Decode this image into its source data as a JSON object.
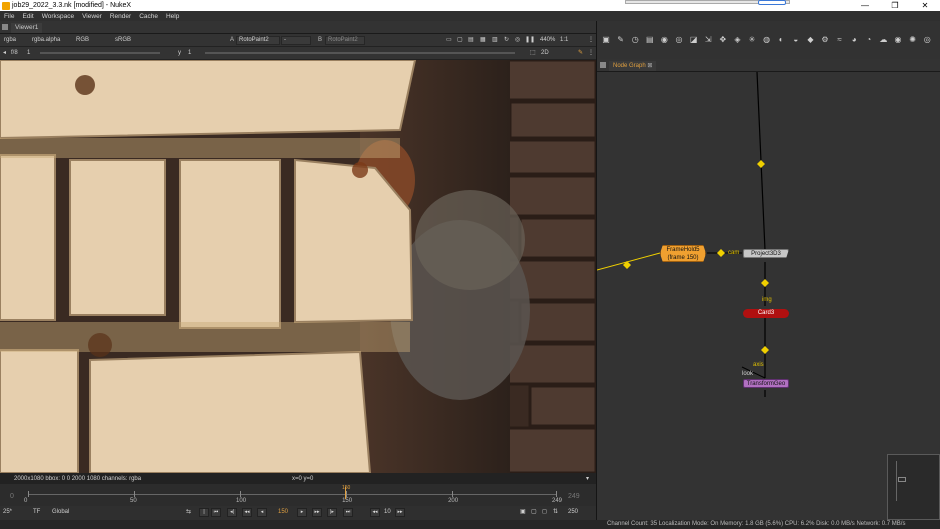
{
  "window": {
    "title": "job29_2022_3.3.nk [modified] - NukeX",
    "controls": {
      "minimize": "—",
      "maximize": "❐",
      "close": "✕"
    }
  },
  "menu": [
    "File",
    "Edit",
    "Workspace",
    "Viewer",
    "Render",
    "Cache",
    "Help"
  ],
  "viewer": {
    "tab_label": "Viewer1",
    "channels": "rgba",
    "alpha": "rgba.alpha",
    "colorspace": "RGB",
    "lut": "sRGB",
    "input_a_letter": "A",
    "input_a": "RotoPaint2",
    "composite": "-",
    "input_b_letter": "B",
    "input_b": "RotoPaint2",
    "zoom": "440%",
    "proxy": "1:1",
    "fstop": "f/8",
    "frame_step": "1",
    "y_label": "y",
    "y_value": "1",
    "view_mode": "2D",
    "info_format": "2000x1080  bbox: 0 0 2000 1080  channels: rgba",
    "info_coords": "x=0 y=0"
  },
  "timeline": {
    "start": "0",
    "end": "249",
    "ticks": [
      "0",
      "50",
      "100",
      "150",
      "200",
      "249"
    ],
    "current_frame": "150",
    "fps": "25*",
    "tf": "TF",
    "scope": "Global",
    "frame_field": "150",
    "increment": "10",
    "end_field": "250"
  },
  "toolbar_icons": [
    "image-icon",
    "draw-icon",
    "time-icon",
    "channel-icon",
    "color-icon",
    "filter-icon",
    "keyer-icon",
    "merge-icon",
    "transform-icon",
    "3d-icon",
    "particles-icon",
    "deep-icon",
    "views-icon",
    "metadata-icon",
    "toolsets-icon",
    "other-icon",
    "furnace-icon",
    "ocula-icon",
    "cara-icon",
    "air-icon",
    "smartvector-icon",
    "flare-icon",
    "plugin-icon"
  ],
  "node_graph": {
    "tab_label": "Node Graph",
    "nodes": {
      "framehold": "FrameHold5\n(frame 150)",
      "framehold_line1": "FrameHold5",
      "framehold_line2": "(frame 150)",
      "project3d": "Project3D3",
      "card": "Card3",
      "transformgeo": "TransformGeo"
    },
    "ports": {
      "cam": "cam",
      "img": "img",
      "axis": "axis",
      "look": "look"
    },
    "colors": {
      "framehold": "#f0a030",
      "project3d": "#c8c8c8",
      "card": "#b01010",
      "transformgeo": "#b070c0",
      "link": "#f0d000"
    }
  },
  "status": "Channel Count: 35  Localization Mode: On  Memory: 1.8 GB (5.6%)  CPU: 6.2%  Disk: 0.0 MB/s  Network: 0.7 MB/s"
}
